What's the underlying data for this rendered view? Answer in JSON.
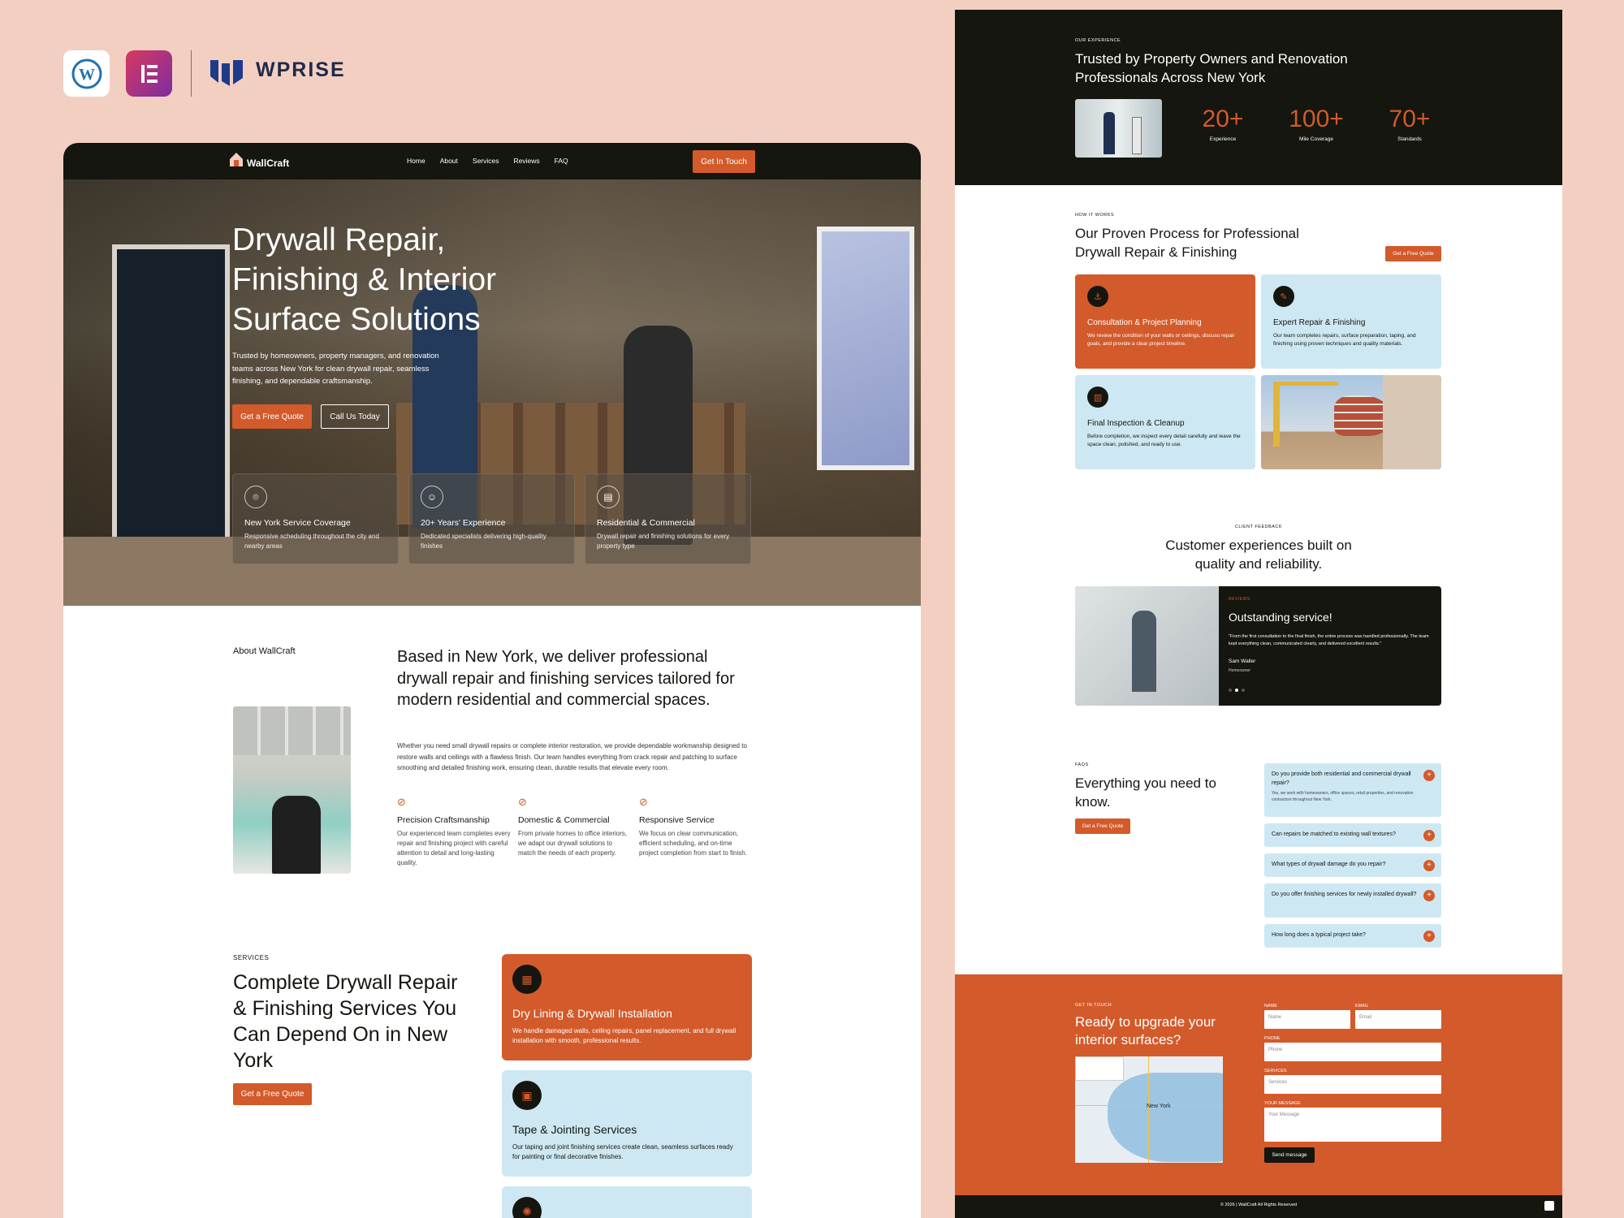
{
  "brand": {
    "name": "WPRISE",
    "icons": [
      "wordpress-icon",
      "elementor-icon",
      "wprise-logo-icon"
    ]
  },
  "nav": {
    "logo": "WallCraft",
    "links": [
      "Home",
      "About",
      "Services",
      "Reviews",
      "FAQ"
    ],
    "cta": "Get In Touch"
  },
  "hero": {
    "title": "Drywall Repair, Finishing & Interior Surface Solutions",
    "subtitle": "Trusted by homeowners, property managers, and renovation teams across New York for clean drywall repair, seamless finishing, and dependable craftsmanship.",
    "primary_btn": "Get a Free Quote",
    "secondary_btn": "Call Us Today",
    "cards": [
      {
        "icon": "location-pin-icon",
        "title": "New York Service Coverage",
        "text": "Responsive scheduling throughout the city and nearby areas"
      },
      {
        "icon": "worker-icon",
        "title": "20+ Years' Experience",
        "text": "Dedicated specialists delivering high-quality finishes"
      },
      {
        "icon": "building-icon",
        "title": "Residential & Commercial",
        "text": "Drywall repair and finishing solutions for every property type"
      }
    ]
  },
  "about": {
    "label": "About WallCraft",
    "heading": "Based in New York, we deliver professional drywall repair and finishing services tailored for modern residential and commercial spaces.",
    "body": "Whether you need small drywall repairs or complete interior restoration, we provide dependable workmanship designed to restore walls and ceilings with a flawless finish. Our team handles everything from crack repair and patching to surface smoothing and detailed finishing work, ensuring clean, durable results that elevate every room.",
    "features": [
      {
        "title": "Precision Craftsmanship",
        "text": "Our experienced team completes every repair and finishing project with careful attention to detail and long-lasting quality."
      },
      {
        "title": "Domestic & Commercial",
        "text": "From private homes to office interiors, we adapt our drywall solutions to match the needs of each property."
      },
      {
        "title": "Responsive Service",
        "text": "We focus on clear communication, efficient scheduling, and on-time project completion from start to finish."
      }
    ]
  },
  "services": {
    "label": "SERVICES",
    "heading": "Complete Drywall Repair & Finishing Services You Can Depend On in New York",
    "btn": "Get a Free Quote",
    "items": [
      {
        "icon": "drywall-icon",
        "title": "Dry Lining & Drywall Installation",
        "text": "We handle damaged walls, ceiling repairs, panel replacement, and full drywall installation with smooth, professional results."
      },
      {
        "icon": "tape-icon",
        "title": "Tape & Jointing Services",
        "text": "Our taping and joint finishing services create clean, seamless surfaces ready for painting or final decorative finishes."
      }
    ]
  },
  "experience": {
    "label": "OUR EXPERIENCE",
    "heading": "Trusted by Property Owners and Renovation Professionals Across New York",
    "stats": [
      {
        "value": "20+",
        "label": "Experience"
      },
      {
        "value": "100+",
        "label": "Mile Coverage"
      },
      {
        "value": "70+",
        "label": "Standards"
      }
    ]
  },
  "process": {
    "label": "HOW IT WORKS",
    "heading": "Our Proven Process for Professional Drywall Repair & Finishing",
    "btn": "Get a Free Quote",
    "steps": [
      {
        "icon": "anchor-icon",
        "title": "Consultation & Project Planning",
        "text": "We review the condition of your walls or ceilings, discuss repair goals, and provide a clear project timeline."
      },
      {
        "icon": "brush-icon",
        "title": "Expert Repair & Finishing",
        "text": "Our team completes repairs, surface preparation, taping, and finishing using proven techniques and quality materials."
      },
      {
        "icon": "clipboard-icon",
        "title": "Final Inspection & Cleanup",
        "text": "Before completion, we inspect every detail carefully and leave the space clean, polished, and ready to use."
      }
    ]
  },
  "feedback": {
    "label": "CLIENT FEEDBACK",
    "heading": "Customer experiences built on quality and reliability.",
    "tag": "REVIEWS",
    "title": "Outstanding service!",
    "quote": "\"From the first consultation to the final finish, the entire process was handled professionally. The team kept everything clean, communicated clearly, and delivered excellent results.\"",
    "author": "Sam Waller",
    "role": "Homeowner"
  },
  "faqs": {
    "label": "FAQS",
    "heading": "Everything you need to know.",
    "btn": "Get a Free Quote",
    "items": [
      {
        "q": "Do you provide both residential and commercial drywall repair?",
        "a": "Yes, we work with homeowners, office spaces, retail properties, and renovation contractors throughout New York."
      },
      {
        "q": "Can repairs be matched to existing wall textures?",
        "a": ""
      },
      {
        "q": "What types of drywall damage do you repair?",
        "a": ""
      },
      {
        "q": "Do you offer finishing services for newly installed drywall?",
        "a": ""
      },
      {
        "q": "How long does a typical project take?",
        "a": ""
      }
    ]
  },
  "contact": {
    "label": "GET IN TOUCH",
    "heading": "Ready to upgrade your interior surfaces?",
    "map_label": "New York",
    "fields": {
      "name_label": "NAME",
      "name_ph": "Name",
      "email_label": "EMAIL",
      "email_ph": "Email",
      "phone_label": "PHONE",
      "phone_ph": "Phone",
      "services_label": "SERVICES",
      "services_ph": "Services",
      "message_label": "YOUR MESSAGE",
      "message_ph": "Your Message"
    },
    "submit": "Send message"
  },
  "footer": {
    "copyright": "© 2026 | WallCraft All Rights Reserved"
  },
  "colors": {
    "accent": "#d35a2a",
    "dark": "#14160f",
    "light_blue": "#cde8f3",
    "background": "#f3cfc2"
  }
}
